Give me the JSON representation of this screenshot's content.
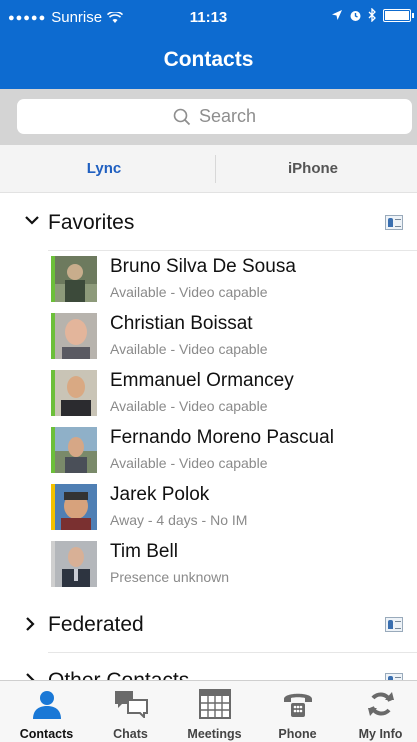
{
  "status_bar": {
    "carrier": "Sunrise",
    "time": "11:13"
  },
  "header": {
    "title": "Contacts"
  },
  "search": {
    "placeholder": "Search"
  },
  "segments": {
    "lync": "Lync",
    "iphone": "iPhone"
  },
  "groups": [
    {
      "label": "Favorites",
      "expanded": true
    },
    {
      "label": "Federated",
      "expanded": false
    },
    {
      "label": "Other Contacts",
      "expanded": false
    }
  ],
  "contacts": [
    {
      "name": "Bruno Silva De Sousa",
      "status": "Available - Video capable",
      "presence_color": "#6cbf3a"
    },
    {
      "name": "Christian Boissat",
      "status": "Available - Video capable",
      "presence_color": "#6cbf3a"
    },
    {
      "name": "Emmanuel Ormancey",
      "status": "Available - Video capable",
      "presence_color": "#6cbf3a"
    },
    {
      "name": "Fernando Moreno Pascual",
      "status": "Available - Video capable",
      "presence_color": "#6cbf3a"
    },
    {
      "name": "Jarek Polok",
      "status": "Away - 4 days - No IM",
      "presence_color": "#f2c200"
    },
    {
      "name": "Tim Bell",
      "status": "Presence unknown",
      "presence_color": "#cfcfcf"
    }
  ],
  "tabs": [
    {
      "label": "Contacts",
      "icon": "person-icon",
      "active": true
    },
    {
      "label": "Chats",
      "icon": "chat-bubbles-icon",
      "active": false
    },
    {
      "label": "Meetings",
      "icon": "calendar-icon",
      "active": false
    },
    {
      "label": "Phone",
      "icon": "phone-icon",
      "active": false
    },
    {
      "label": "My Info",
      "icon": "sync-arrows-icon",
      "active": false
    }
  ],
  "colors": {
    "header_bg": "#0d6bd0",
    "accent": "#1f5fc0",
    "available": "#6cbf3a",
    "away": "#f2c200",
    "unknown": "#cfcfcf"
  }
}
